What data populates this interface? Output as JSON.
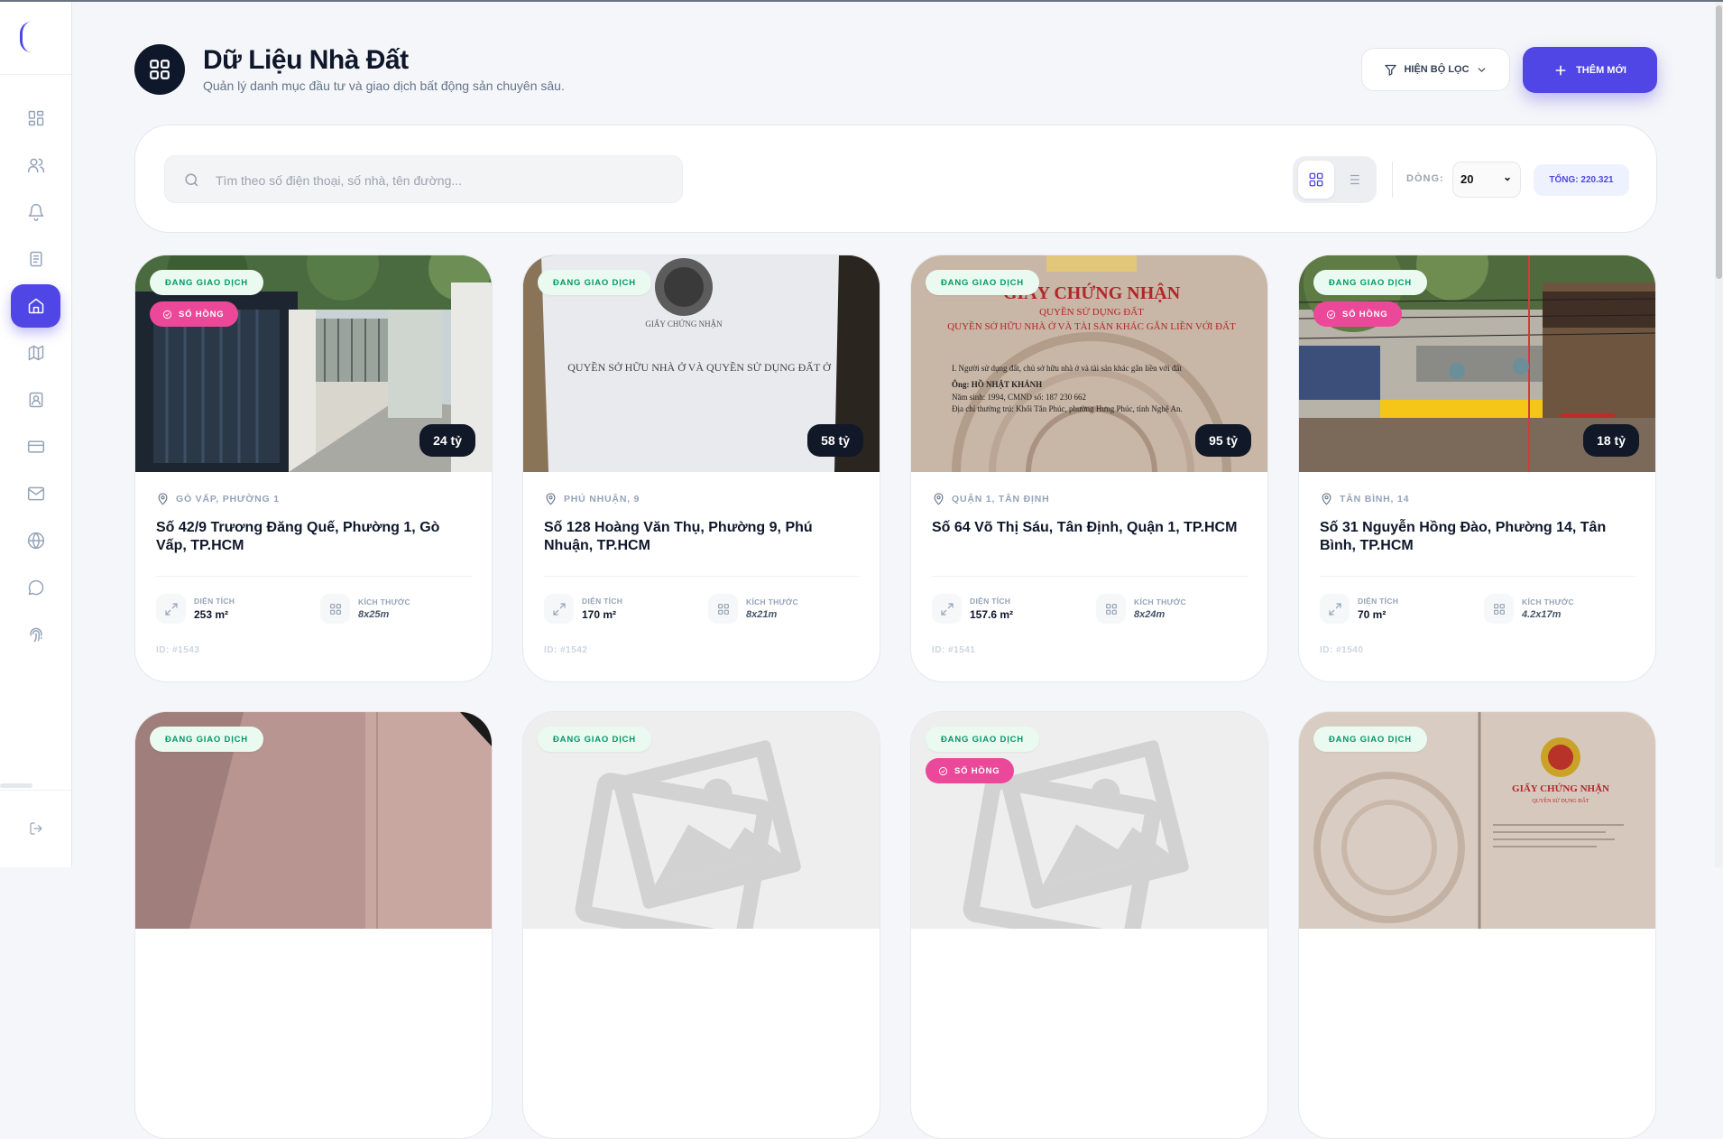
{
  "header": {
    "title": "Dữ Liệu Nhà Đất",
    "subtitle": "Quản lý danh mục đầu tư và giao dịch bất động sản chuyên sâu.",
    "filter_label": "HIỆN BỘ LỌC",
    "add_label": "THÊM MỚI"
  },
  "toolbar": {
    "search_placeholder": "Tìm theo số điện thoại, số nhà, tên đường...",
    "rows_label": "DÒNG:",
    "rows_value": "20",
    "total": "TỔNG: 220.321"
  },
  "sidebar": {
    "items": [
      "dashboard-icon",
      "users-icon",
      "bell-icon",
      "document-icon",
      "home-icon",
      "map-icon",
      "contact-icon",
      "card-icon",
      "mail-icon",
      "globe-icon",
      "chat-icon",
      "fingerprint-icon"
    ],
    "active": "home-icon",
    "logout": "logout-icon"
  },
  "cards": [
    {
      "status": "ĐANG GIAO DỊCH",
      "pink": "SỔ HỒNG",
      "price": "24 tỷ",
      "location": "GÒ VẤP, PHƯỜNG 1",
      "address": "Số 42/9 Trương Đăng Quế, Phường 1, Gò Vấp, TP.HCM",
      "area_label": "DIỆN TÍCH",
      "area": "253 m²",
      "size_label": "KÍCH THƯỚC",
      "size": "8x25m",
      "id": "ID: #1543"
    },
    {
      "status": "ĐANG GIAO DỊCH",
      "price": "58 tỷ",
      "location": "PHÚ NHUẬN, 9",
      "address": "Số 128 Hoàng Văn Thụ, Phường 9, Phú Nhuận, TP.HCM",
      "area_label": "DIỆN TÍCH",
      "area": "170 m²",
      "size_label": "KÍCH THƯỚC",
      "size": "8x21m",
      "id": "ID: #1542"
    },
    {
      "status": "ĐANG GIAO DỊCH",
      "price": "95 tỷ",
      "location": "QUẬN 1, TÂN ĐỊNH",
      "address": "Số 64 Võ Thị Sáu, Tân Định, Quận 1, TP.HCM",
      "area_label": "DIỆN TÍCH",
      "area": "157.6 m²",
      "size_label": "KÍCH THƯỚC",
      "size": "8x24m",
      "id": "ID: #1541"
    },
    {
      "status": "ĐANG GIAO DỊCH",
      "pink": "SỔ HỒNG",
      "price": "18 tỷ",
      "location": "TÂN BÌNH, 14",
      "address": "Số 31 Nguyễn Hồng Đào, Phường 14, Tân Bình, TP.HCM",
      "area_label": "DIỆN TÍCH",
      "area": "70 m²",
      "size_label": "KÍCH THƯỚC",
      "size": "4.2x17m",
      "id": "ID: #1540"
    },
    {
      "status": "ĐANG GIAO DỊCH"
    },
    {
      "status": "ĐANG GIAO DỊCH"
    },
    {
      "status": "ĐANG GIAO DỊCH",
      "pink": "SỔ HỒNG"
    },
    {
      "status": "ĐANG GIAO DỊCH"
    }
  ],
  "colors": {
    "accent": "#4f46e5",
    "deal_badge_bg": "#eafaf1",
    "deal_badge_text": "#059669",
    "pink_badge": "#ec4899",
    "price_bg": "#111827"
  }
}
